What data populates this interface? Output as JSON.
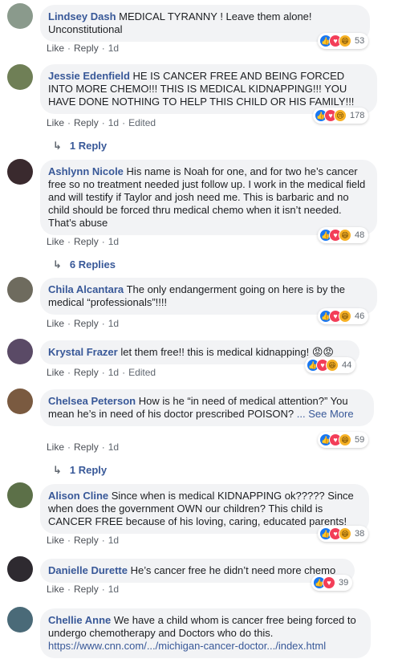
{
  "comments": [
    {
      "author": "Lindsey Dash",
      "text": "MEDICAL TYRANNY ! Leave them alone! Unconstitutional",
      "like": "Like",
      "reply": "Reply",
      "time": "1d",
      "edited": "",
      "reaction_count": "53",
      "avatar_color": "#8a9a8c"
    },
    {
      "author": "Jessie Edenfield",
      "text": "HE IS CANCER FREE AND BEING FORCED INTO MORE CHEMO!!! THIS IS MEDICAL KIDNAPPING!!! YOU HAVE DONE NOTHING TO HELP THIS CHILD OR HIS FAMILY!!!",
      "like": "Like",
      "reply": "Reply",
      "time": "1d",
      "edited": "Edited",
      "reaction_count": "178",
      "replies": "1 Reply",
      "avatar_color": "#6f7f56"
    },
    {
      "author": "Ashlynn Nicole",
      "text": "His name is Noah for one, and for two he’s cancer free so no treatment needed just follow up. I work in the medical field and will testify if Taylor and josh need me. This is barbaric and no child should be forced thru medical chemo when it isn’t needed. That’s abuse",
      "like": "Like",
      "reply": "Reply",
      "time": "1d",
      "edited": "",
      "reaction_count": "48",
      "replies": "6 Replies",
      "avatar_color": "#3a2a2e"
    },
    {
      "author": "Chila Alcantara",
      "text": "The only endangerment going on here is by the medical “professionals”!!!!",
      "like": "Like",
      "reply": "Reply",
      "time": "1d",
      "edited": "",
      "reaction_count": "46",
      "avatar_color": "#6e6b5e"
    },
    {
      "author": "Krystal Frazer",
      "text": "let them free!! this is medical kidnapping!",
      "like": "Like",
      "reply": "Reply",
      "time": "1d",
      "edited": "Edited",
      "reaction_count": "44",
      "avatar_color": "#5a4a66"
    },
    {
      "author": "Chelsea Peterson",
      "text": "How is he “in need of medical attention?” You mean he’s in need of his doctor prescribed POISON?",
      "see_more": "... See More",
      "like": "Like",
      "reply": "Reply",
      "time": "1d",
      "edited": "",
      "reaction_count": "59",
      "replies": "1 Reply",
      "avatar_color": "#7a5a40"
    },
    {
      "author": "Alison Cline",
      "text": "Since when is medical KIDNAPPING ok????? Since when does the government OWN our children? This child is CANCER FREE because of his loving, caring, educated parents!",
      "like": "Like",
      "reply": "Reply",
      "time": "1d",
      "edited": "",
      "reaction_count": "38",
      "avatar_color": "#5c7048"
    },
    {
      "author": "Danielle Durette",
      "text": "He’s cancer free he didn’t need more chemo",
      "like": "Like",
      "reply": "Reply",
      "time": "1d",
      "edited": "",
      "reaction_count": "39",
      "avatar_color": "#2e2a30"
    },
    {
      "author": "Chellie Anne",
      "text": "We have a child whom is cancer free being forced to undergo chemotherapy and Doctors who do this.",
      "link": "https://www.cnn.com/.../michigan-cancer-doctor.../index.html",
      "avatar_color": "#4a6a78"
    }
  ],
  "colors": {
    "author": "#385898",
    "bubble": "#f2f3f5",
    "meta": "#606770",
    "like_blue": "#1877f2",
    "love_red": "#f33e58",
    "haha_yellow": "#f7b125"
  },
  "icons": {
    "reply_arrow": "reply-arrow-icon",
    "like": "like-icon",
    "love": "love-icon",
    "haha": "haha-icon",
    "sad": "sad-icon",
    "angry": "angry-icon"
  }
}
